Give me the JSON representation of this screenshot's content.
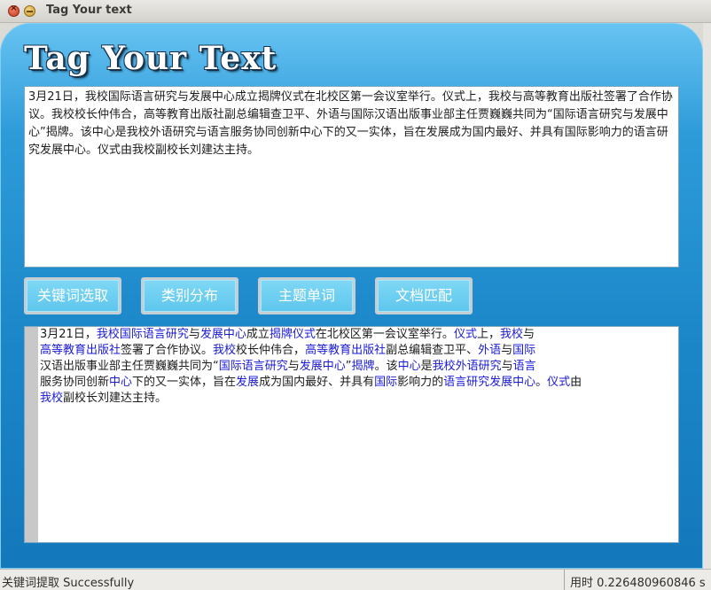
{
  "window": {
    "title": "Tag Your text",
    "close_icon": "close-icon",
    "minimize_icon": "minimize-icon"
  },
  "app": {
    "title": "Tag Your Text",
    "accent_color": "#1a86c8",
    "keyword_color": "#1a1ad4"
  },
  "input": {
    "text": "3月21日，我校国际语言研究与发展中心成立揭牌仪式在北校区第一会议室举行。仪式上，我校与高等教育出版社签署了合作协议。我校校长仲伟合，高等教育出版社副总编辑查卫平、外语与国际汉语出版事业部主任贾巍巍共同为“国际语言研究与发展中心”揭牌。该中心是我校外语研究与语言服务协同创新中心下的又一实体，旨在发展成为国内最好、并具有国际影响力的语言研究发展中心。仪式由我校副校长刘建达主持。"
  },
  "buttons": [
    {
      "label": "关键词选取"
    },
    {
      "label": "类别分布"
    },
    {
      "label": "主题单词"
    },
    {
      "label": "文档匹配"
    }
  ],
  "output": {
    "segments": [
      {
        "t": "3月21日，",
        "k": false
      },
      {
        "t": "我校",
        "k": true
      },
      {
        "t": "国际语言研究",
        "k": true
      },
      {
        "t": "与",
        "k": false
      },
      {
        "t": "发展中心",
        "k": true
      },
      {
        "t": "成立",
        "k": false
      },
      {
        "t": "揭牌仪式",
        "k": true
      },
      {
        "t": "在北校区第一会议室举行。",
        "k": false
      },
      {
        "t": "仪式",
        "k": true
      },
      {
        "t": "上，",
        "k": false
      },
      {
        "t": "我校",
        "k": true
      },
      {
        "t": "与",
        "k": false
      },
      {
        "br": true
      },
      {
        "t": "高等教育出版社",
        "k": true
      },
      {
        "t": "签署了合作协议。",
        "k": false
      },
      {
        "t": "我校",
        "k": true
      },
      {
        "t": "校长仲伟合，",
        "k": false
      },
      {
        "t": "高等教育出版社",
        "k": true
      },
      {
        "t": "副总编辑查卫平、",
        "k": false
      },
      {
        "t": "外语",
        "k": true
      },
      {
        "t": "与",
        "k": false
      },
      {
        "t": "国际",
        "k": true
      },
      {
        "br": true
      },
      {
        "t": "汉语出版事业部主任贾巍巍共同为“",
        "k": false
      },
      {
        "t": "国际语言研究",
        "k": true
      },
      {
        "t": "与",
        "k": false
      },
      {
        "t": "发展中心",
        "k": true
      },
      {
        "t": "”",
        "k": false
      },
      {
        "t": "揭牌",
        "k": true
      },
      {
        "t": "。该",
        "k": false
      },
      {
        "t": "中心",
        "k": true
      },
      {
        "t": "是",
        "k": false
      },
      {
        "t": "我校外语研究",
        "k": true
      },
      {
        "t": "与",
        "k": false
      },
      {
        "t": "语言",
        "k": true
      },
      {
        "br": true
      },
      {
        "t": "服务协同创新",
        "k": false
      },
      {
        "t": "中心",
        "k": true
      },
      {
        "t": "下的又一实体，旨在",
        "k": false
      },
      {
        "t": "发展",
        "k": true
      },
      {
        "t": "成为国内最好、并具有",
        "k": false
      },
      {
        "t": "国际",
        "k": true
      },
      {
        "t": "影响力的",
        "k": false
      },
      {
        "t": "语言研究发展中心",
        "k": true
      },
      {
        "t": "。",
        "k": false
      },
      {
        "t": "仪式",
        "k": true
      },
      {
        "t": "由",
        "k": false
      },
      {
        "br": true
      },
      {
        "t": "我校",
        "k": true
      },
      {
        "t": "副校长刘建达主持。",
        "k": false
      }
    ]
  },
  "status": {
    "message": "关键词提取 Successfully",
    "timing": "用时  0.226480960846 s"
  }
}
